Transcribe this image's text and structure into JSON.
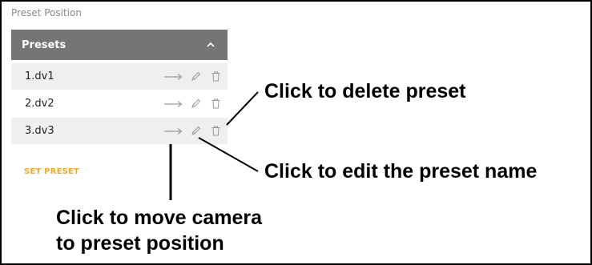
{
  "section_title": "Preset Position",
  "presets_panel": {
    "title": "Presets",
    "collapse_icon": "chevron-up-icon",
    "items": [
      {
        "label": "1.dv1",
        "shaded": true
      },
      {
        "label": "2.dv2",
        "shaded": false
      },
      {
        "label": "3.dv3",
        "shaded": true
      }
    ],
    "item_icons": [
      "arrow-right-icon",
      "pencil-icon",
      "trash-icon"
    ]
  },
  "set_preset_label": "SET PRESET",
  "annotations": {
    "delete": "Click to delete preset",
    "edit": "Click to edit the preset name",
    "move_line1": "Click to move camera",
    "move_line2": "to preset position"
  },
  "colors": {
    "header_bg": "#757575",
    "row_shade": "#efefef",
    "accent": "#f0a928",
    "icon_gray": "#9a9a9a"
  }
}
